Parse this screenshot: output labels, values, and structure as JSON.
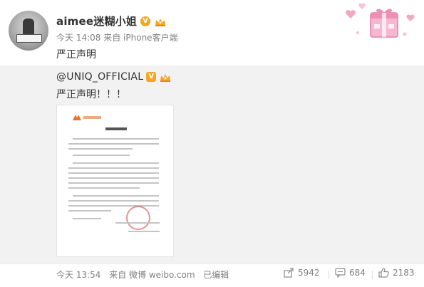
{
  "post": {
    "username": "aimee迷糊小姐",
    "timestamp": "今天 14:08",
    "source": "来自 iPhone客户端",
    "text": "严正声明"
  },
  "repost": {
    "author": "@UNIQ_OFFICIAL",
    "text": "严正声明！！！"
  },
  "footer": {
    "timestamp": "今天 13:54",
    "source": "来自 微博 weibo.com",
    "edited": "已编辑",
    "shares": "5942",
    "comments": "684",
    "likes": "2183"
  },
  "colors": {
    "verified": "#f5a623",
    "meta_text": "#808080",
    "repost_bg": "#f2f2f2",
    "stamp": "#d63c3c"
  },
  "icons": {
    "verified": "verified-v-icon",
    "member": "member-crown-icon",
    "share": "share-icon",
    "comment": "comment-icon",
    "like": "thumbs-up-icon",
    "sticker": "gift-sticker-icon"
  }
}
